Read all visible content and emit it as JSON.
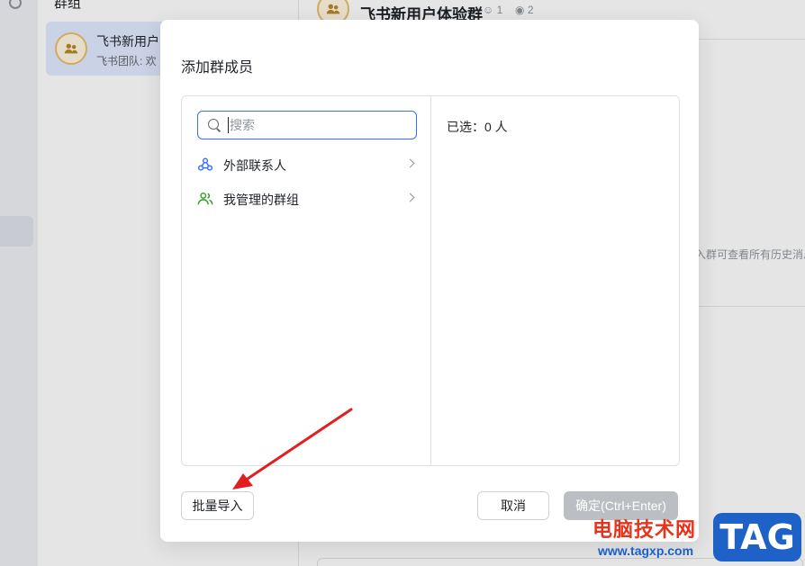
{
  "background": {
    "list_title": "群组",
    "chat_name": "飞书新用户",
    "chat_sub": "飞书团队: 欢",
    "header_title": "飞书新用户体验群",
    "header_members": "1",
    "header_bots": "2",
    "history_hint": "入群可查看所有历史消息"
  },
  "dialog": {
    "title": "添加群成员",
    "search_placeholder": "搜索",
    "categories": [
      {
        "label": "外部联系人",
        "icon": "external-contacts-icon",
        "color": "#3370ff"
      },
      {
        "label": "我管理的群组",
        "icon": "managed-groups-icon",
        "color": "#2ea121"
      }
    ],
    "selected_label": "已选：0 人",
    "import_label": "批量导入",
    "cancel_label": "取消",
    "confirm_label": "确定(Ctrl+Enter)"
  },
  "watermark": {
    "text": "电脑技术网",
    "url": "www.tagxp.com",
    "tag": "TAG"
  },
  "colors": {
    "accent": "#3370ff",
    "annotation": "#e02020"
  }
}
